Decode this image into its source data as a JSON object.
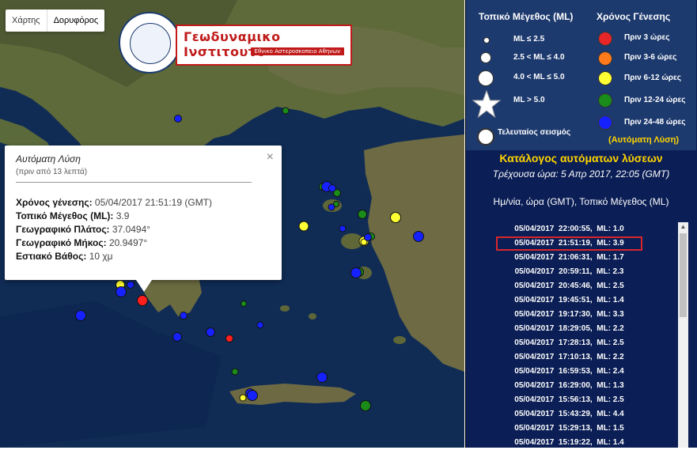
{
  "map": {
    "map_type_buttons": [
      "Χάρτης",
      "Δορυφόρος"
    ],
    "logo": {
      "title": "Γεωδυναμικο Ινστιτουτο",
      "subtitle": "Εθνικο Αστεροσκοπειο Αθηνων"
    },
    "quakes": [
      {
        "color": "#ff1f1f",
        "size": 14,
        "class": "red"
      },
      {
        "color": "#ff1f1f",
        "size": 10,
        "class": "red"
      },
      {
        "color": "#ffff33",
        "size": 12,
        "class": "yellow"
      },
      {
        "color": "#ffff33",
        "size": 13,
        "class": "yellow"
      },
      {
        "color": "#ffff33",
        "size": 14,
        "class": "yellow"
      },
      {
        "color": "#ffff33",
        "size": 13,
        "class": "yellow"
      },
      {
        "color": "#ffff33",
        "size": 9,
        "class": "yellow"
      },
      {
        "color": "#ffff33",
        "size": 9,
        "class": "yellow"
      },
      {
        "color": "#1a8c1a",
        "size": 12,
        "class": "green"
      },
      {
        "color": "#1a8c1a",
        "size": 9,
        "class": "green"
      },
      {
        "color": "#1a8c1a",
        "size": 8,
        "class": "green"
      },
      {
        "color": "#1a8c1a",
        "size": 10,
        "class": "green"
      },
      {
        "color": "#1a8c1a",
        "size": 14,
        "class": "green"
      },
      {
        "color": "#1a8c1a",
        "size": 10,
        "class": "green"
      },
      {
        "color": "#1a8c1a",
        "size": 10,
        "class": "green"
      },
      {
        "color": "#1a8c1a",
        "size": 9,
        "class": "green"
      },
      {
        "color": "#1a8c1a",
        "size": 8,
        "class": "green"
      },
      {
        "color": "#1a8c1a",
        "size": 12,
        "class": "green"
      },
      {
        "color": "#1522ff",
        "size": 10,
        "class": "blue"
      },
      {
        "color": "#1522ff",
        "size": 14,
        "class": "blue"
      },
      {
        "color": "#1522ff",
        "size": 14,
        "class": "blue"
      },
      {
        "color": "#1522ff",
        "size": 10,
        "class": "blue"
      },
      {
        "color": "#1522ff",
        "size": 14,
        "class": "blue"
      },
      {
        "color": "#1522ff",
        "size": 9,
        "class": "blue"
      },
      {
        "color": "#1522ff",
        "size": 14,
        "class": "blue"
      },
      {
        "color": "#1522ff",
        "size": 12,
        "class": "blue"
      },
      {
        "color": "#1522ff",
        "size": 10,
        "class": "blue"
      },
      {
        "color": "#1522ff",
        "size": 12,
        "class": "blue"
      },
      {
        "color": "#1522ff",
        "size": 14,
        "class": "blue"
      },
      {
        "color": "#1522ff",
        "size": 12,
        "class": "blue"
      },
      {
        "color": "#1522ff",
        "size": 9,
        "class": "blue"
      },
      {
        "color": "#1522ff",
        "size": 14,
        "class": "blue"
      },
      {
        "color": "#1522ff",
        "size": 14,
        "class": "blue"
      },
      {
        "color": "#1522ff",
        "size": 10,
        "class": "blue"
      },
      {
        "color": "#1522ff",
        "size": 10,
        "class": "blue"
      },
      {
        "color": "#1522ff",
        "size": 9,
        "class": "blue"
      }
    ],
    "infowindow": {
      "title": "Αυτόματη Λύση",
      "subtitle": "(πριν από 13 λεπτά)",
      "close": "×",
      "rows": [
        {
          "label": "Χρόνος γένεσης:",
          "value": "05/04/2017  21:51:19 (GMT)"
        },
        {
          "label": "Τοπικό Μέγεθος (ML):",
          "value": "3.9"
        },
        {
          "label": "Γεωγραφικό Πλάτος:",
          "value": "37.0494°"
        },
        {
          "label": "Γεωγραφικό Μήκος:",
          "value": "20.9497°"
        },
        {
          "label": "Εστιακό Βάθος:",
          "value": "10 χμ"
        }
      ]
    }
  },
  "legend": {
    "magnitude_header": "Τοπικό Μέγεθος (ML)",
    "time_header": "Χρόνος Γένεσης",
    "magnitudes": [
      "ML ≤ 2.5",
      "2.5 < ML ≤ 4.0",
      "4.0 < ML ≤ 5.0",
      "ML > 5.0"
    ],
    "last_quake": "Τελευταίος σεισμός",
    "times": [
      {
        "label": "Πριν 3 ώρες",
        "color": "#e8262a"
      },
      {
        "label": "Πριν 3-6 ώρες",
        "color": "#ff7a1a"
      },
      {
        "label": "Πριν 6-12 ώρες",
        "color": "#ffff33"
      },
      {
        "label": "Πριν 12-24 ώρες",
        "color": "#1a8c1a"
      },
      {
        "label": "Πριν 24-48 ώρες",
        "color": "#1522ff"
      }
    ],
    "auto_note": "(Αυτόματη Λύση)"
  },
  "catalog": {
    "title": "Κατάλογος αυτόματων λύσεων",
    "current_time": "Τρέχουσα ώρα: 5 Απρ 2017, 22:05 (GMT)",
    "columns": "Ημ/νία, ώρα (GMT), Τοπικό Μέγεθος (ML)",
    "entries": [
      "05/04/2017  22:00:55,  ML: 1.0",
      "05/04/2017  21:51:19,  ML: 3.9",
      "05/04/2017  21:06:31,  ML: 1.7",
      "05/04/2017  20:59:11,  ML: 2.3",
      "05/04/2017  20:45:46,  ML: 2.5",
      "05/04/2017  19:45:51,  ML: 1.4",
      "05/04/2017  19:17:30,  ML: 3.3",
      "05/04/2017  18:29:05,  ML: 2.2",
      "05/04/2017  17:28:13,  ML: 2.5",
      "05/04/2017  17:10:13,  ML: 2.2",
      "05/04/2017  16:59:53,  ML: 2.4",
      "05/04/2017  16:29:00,  ML: 1.3",
      "05/04/2017  15:56:13,  ML: 2.5",
      "05/04/2017  15:43:29,  ML: 4.4",
      "05/04/2017  15:29:13,  ML: 1.5",
      "05/04/2017  15:19:22,  ML: 1.4"
    ],
    "selected_index": 1
  }
}
